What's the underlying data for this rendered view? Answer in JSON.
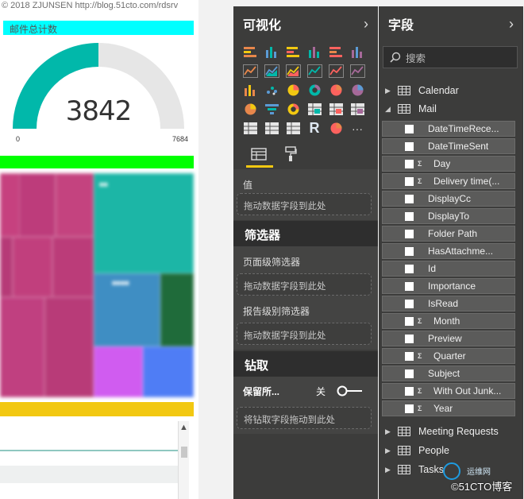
{
  "watermark": "© 2018 ZJUNSEN http://blog.51cto.com/rdsrv",
  "report": {
    "gauge": {
      "title": "邮件总计数",
      "value": "3842",
      "min": "0",
      "max": "7684",
      "fill_fraction": 0.5,
      "fill_color": "#01b8aa",
      "track_color": "#e6e6e6"
    },
    "colors": {
      "title_bar": "#00ffff",
      "green_bar": "#00ff00",
      "yellow_bar": "#f2c811"
    },
    "table": {
      "scroll_up_icon": "▲"
    }
  },
  "viz_pane": {
    "title": "可视化",
    "collapse_icon": "chevron-right-icon",
    "icons": [
      "stacked-bar-icon",
      "stacked-column-icon",
      "clustered-bar-icon",
      "clustered-column-icon",
      "100-stacked-bar-icon",
      "100-stacked-column-icon",
      "line-chart-icon",
      "area-chart-icon",
      "stacked-area-icon",
      "line-column-icon",
      "line-clustered-column-icon",
      "ribbon-chart-icon",
      "waterfall-icon",
      "scatter-icon",
      "pie-chart-icon",
      "donut-chart-icon",
      "treemap-icon",
      "map-icon",
      "filled-map-icon",
      "funnel-icon",
      "gauge-icon",
      "card-icon",
      "multi-row-card-icon",
      "kpi-icon",
      "slicer-icon",
      "table-icon",
      "matrix-icon",
      "r-visual-icon",
      "globe-icon",
      "more-icon"
    ],
    "r_visual_label": "R",
    "more_label": "···",
    "tabs": [
      "fields-tab-icon",
      "format-roller-icon"
    ],
    "values_label": "值",
    "values_drop": "拖动数据字段到此处",
    "filters_header": "筛选器",
    "page_filter_label": "页面级筛选器",
    "page_filter_drop": "拖动数据字段到此处",
    "report_filter_label": "报告级别筛选器",
    "report_filter_drop": "拖动数据字段到此处",
    "drill_header": "钻取",
    "keep_all_label": "保留所...",
    "toggle_state": "关",
    "drill_drop": "将钻取字段拖动到此处"
  },
  "fields_pane": {
    "title": "字段",
    "collapse_icon": "chevron-right-icon",
    "search_placeholder": "搜索",
    "tables_top": [
      {
        "name": "Calendar",
        "expanded": false
      },
      {
        "name": "Mail",
        "expanded": true
      }
    ],
    "mail_fields": [
      {
        "name": "DateTimeRece...",
        "sigma": false
      },
      {
        "name": "DateTimeSent",
        "sigma": false
      },
      {
        "name": "Day",
        "sigma": true
      },
      {
        "name": "Delivery time(...",
        "sigma": true
      },
      {
        "name": "DisplayCc",
        "sigma": false
      },
      {
        "name": "DisplayTo",
        "sigma": false
      },
      {
        "name": "Folder Path",
        "sigma": false
      },
      {
        "name": "HasAttachme...",
        "sigma": false
      },
      {
        "name": "Id",
        "sigma": false
      },
      {
        "name": "Importance",
        "sigma": false
      },
      {
        "name": "IsRead",
        "sigma": false
      },
      {
        "name": "Month",
        "sigma": true
      },
      {
        "name": "Preview",
        "sigma": false
      },
      {
        "name": "Quarter",
        "sigma": true
      },
      {
        "name": "Subject",
        "sigma": false
      },
      {
        "name": "With Out Junk...",
        "sigma": true
      },
      {
        "name": "Year",
        "sigma": true
      }
    ],
    "sigma_label": "Σ",
    "tables_bottom": [
      {
        "name": "Meeting Requests",
        "expanded": false
      },
      {
        "name": "People",
        "expanded": false
      },
      {
        "name": "Tasks",
        "expanded": false
      }
    ]
  },
  "site_logo": {
    "main": "©51CTO博客",
    "sub": "运维网"
  }
}
